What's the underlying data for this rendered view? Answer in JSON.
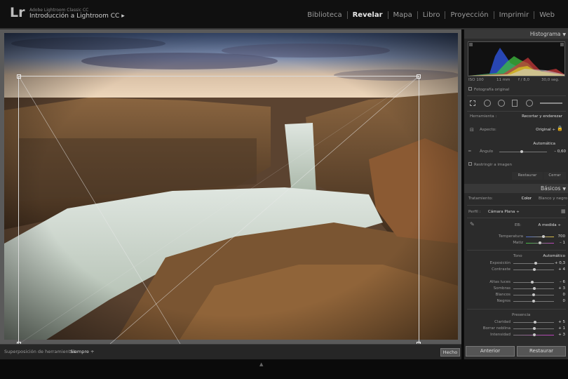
{
  "app": {
    "logo": "Lr",
    "name": "Adobe Lightroom Classic CC",
    "catalog": "Introducción a Lightroom CC ▸"
  },
  "modules": [
    {
      "label": "Biblioteca",
      "active": false
    },
    {
      "label": "Revelar",
      "active": true
    },
    {
      "label": "Mapa",
      "active": false
    },
    {
      "label": "Libro",
      "active": false
    },
    {
      "label": "Proyección",
      "active": false
    },
    {
      "label": "Imprimir",
      "active": false
    },
    {
      "label": "Web",
      "active": false
    }
  ],
  "toolbar": {
    "overlay_label": "Superposición de herramientas:",
    "overlay_value": "Siempre ÷",
    "done_label": "Hecho"
  },
  "histogram": {
    "title": "Histograma",
    "iso": "ISO 100",
    "focal": "11 mm",
    "aperture": "f / 8,0",
    "shutter": "30,0 seg.",
    "original_photo": "Fotografía original"
  },
  "crop": {
    "tool_label": "Herramienta :",
    "tool_value": "Recortar y enderezar",
    "aspect_label": "Aspecto:",
    "aspect_value": "Original ÷",
    "auto_label": "Automática",
    "angle_label": "Ángulo",
    "angle_value": "– 0,60",
    "constrain_label": "Restringir a imagen",
    "reset_label": "Restaurar",
    "close_label": "Cerrar"
  },
  "basics": {
    "title": "Básicos",
    "treatment_label": "Tratamiento:",
    "treatment_color": "Color",
    "treatment_bw": "Blanco y negro",
    "profile_label": "Perfil :",
    "profile_value": "Cámara Plana ÷",
    "wb_label": "EB:",
    "wb_value": "A medida ÷",
    "tone_label": "Tono",
    "tone_auto": "Automático",
    "presence_label": "Presencia"
  },
  "sliders": {
    "temp": {
      "label": "Temperatura",
      "value": "700",
      "level": 0.62
    },
    "tint": {
      "label": "Matiz",
      "value": "– 1",
      "level": 0.5
    },
    "exposure": {
      "label": "Exposición",
      "value": "+ 0,3",
      "level": 0.55
    },
    "contrast": {
      "label": "Contraste",
      "value": "+ 4",
      "level": 0.52
    },
    "highlights": {
      "label": "Altas luces",
      "value": "– 6",
      "level": 0.47
    },
    "shadows": {
      "label": "Sombras",
      "value": "+ 3",
      "level": 0.52
    },
    "whites": {
      "label": "Blancos",
      "value": "0",
      "level": 0.5
    },
    "blacks": {
      "label": "Negros",
      "value": "0",
      "level": 0.5
    },
    "clarity": {
      "label": "Claridad",
      "value": "+ 5",
      "level": 0.53
    },
    "dehaze": {
      "label": "Borrar neblina",
      "value": "+ 1",
      "level": 0.51
    },
    "vibrance": {
      "label": "Intensidad",
      "value": "+ 3",
      "level": 0.52
    }
  },
  "footer": {
    "previous_label": "Anterior",
    "reset_label": "Restaurar"
  },
  "colors": {
    "accent": "#d6d6d6",
    "panel": "#2b2b2b",
    "header": "#383838"
  }
}
